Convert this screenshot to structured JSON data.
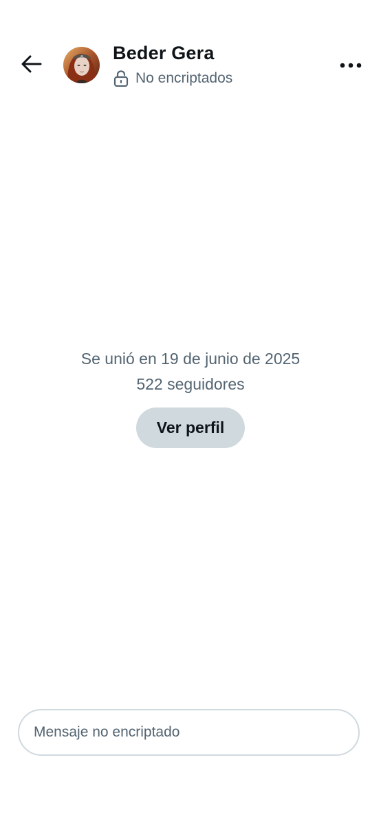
{
  "header": {
    "back_icon": "arrow-left-icon",
    "name": "Beder Gera",
    "encryption_icon": "unlocked-lock-icon",
    "encryption_status": "No encriptados",
    "more_icon": "more-horizontal-icon"
  },
  "profile_summary": {
    "joined": "Se unió en 19 de junio de 2025",
    "followers": "522 seguidores",
    "view_profile_label": "Ver perfil"
  },
  "composer": {
    "placeholder": "Mensaje no encriptado",
    "value": ""
  },
  "colors": {
    "primary_text": "#0f1419",
    "secondary_text": "#536471",
    "button_bg": "#cfd9de",
    "border": "#cfd9de",
    "background": "#ffffff"
  }
}
